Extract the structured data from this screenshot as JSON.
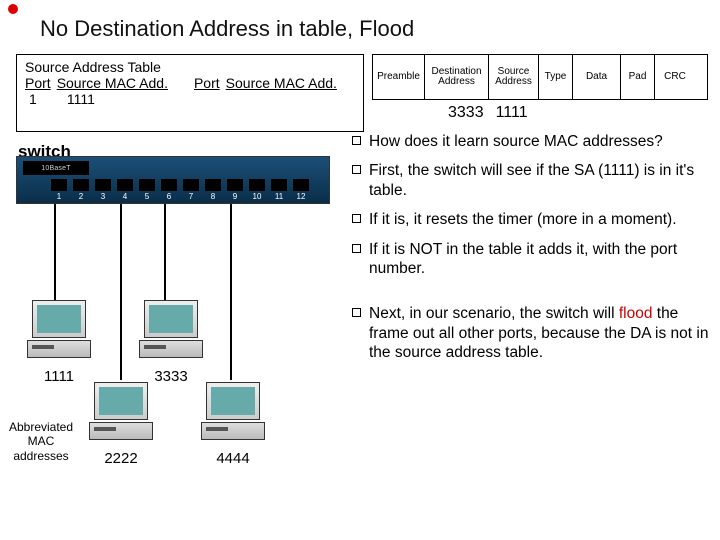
{
  "title": "No Destination Address in table, Flood",
  "src_table": {
    "title": "Source Address Table",
    "cols": [
      "Port",
      "Source MAC Add.",
      "Port",
      "Source MAC Add."
    ],
    "row1_port": "1",
    "row1_mac": "1111"
  },
  "frame": {
    "fields": [
      "Preamble",
      "Destination Address",
      "Source Address",
      "Type",
      "Data",
      "Pad",
      "CRC"
    ],
    "dest_val": "3333",
    "src_val": "1111"
  },
  "switch": {
    "label": "switch",
    "strip": "10BaseT",
    "port_count": 12
  },
  "hosts": {
    "h1": "1111",
    "h2": "2222",
    "h3": "3333",
    "h4": "4444"
  },
  "abbr": "Abbreviated MAC addresses",
  "bullets": [
    "How does it learn source MAC addresses?",
    "First, the switch will see if the SA (1111) is in it's table.",
    "If it is, it resets the timer (more in a moment).",
    "If it is NOT in the table it adds it, with the port number.",
    "Next, in our scenario, the switch will |flood| the frame out all other ports, because the DA is not in the source address table."
  ]
}
